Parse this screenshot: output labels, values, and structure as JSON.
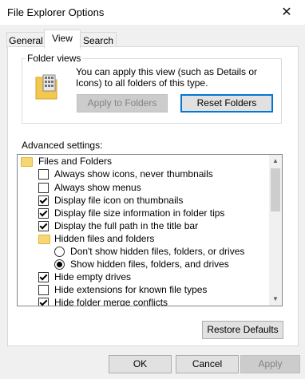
{
  "window": {
    "title": "File Explorer Options",
    "close_glyph": "✕"
  },
  "tabs": [
    {
      "label": "General"
    },
    {
      "label": "View"
    },
    {
      "label": "Search"
    }
  ],
  "folder_views": {
    "legend": "Folder views",
    "description": "You can apply this view (such as Details or Icons) to all folders of this type.",
    "apply_label": "Apply to Folders",
    "reset_label": "Reset Folders"
  },
  "advanced": {
    "label": "Advanced settings:",
    "items": [
      {
        "type": "folder",
        "label": "Files and Folders"
      },
      {
        "type": "checkbox",
        "label": "Always show icons, never thumbnails",
        "checked": false
      },
      {
        "type": "checkbox",
        "label": "Always show menus",
        "checked": false
      },
      {
        "type": "checkbox",
        "label": "Display file icon on thumbnails",
        "checked": true
      },
      {
        "type": "checkbox",
        "label": "Display file size information in folder tips",
        "checked": true
      },
      {
        "type": "checkbox",
        "label": "Display the full path in the title bar",
        "checked": true
      },
      {
        "type": "folder",
        "label": "Hidden files and folders"
      },
      {
        "type": "radio",
        "label": "Don't show hidden files, folders, or drives",
        "checked": false
      },
      {
        "type": "radio",
        "label": "Show hidden files, folders, and drives",
        "checked": true
      },
      {
        "type": "checkbox",
        "label": "Hide empty drives",
        "checked": true
      },
      {
        "type": "checkbox",
        "label": "Hide extensions for known file types",
        "checked": false
      },
      {
        "type": "checkbox",
        "label": "Hide folder merge conflicts",
        "checked": true
      }
    ]
  },
  "restore_label": "Restore Defaults",
  "footer": {
    "ok": "OK",
    "cancel": "Cancel",
    "apply": "Apply"
  }
}
